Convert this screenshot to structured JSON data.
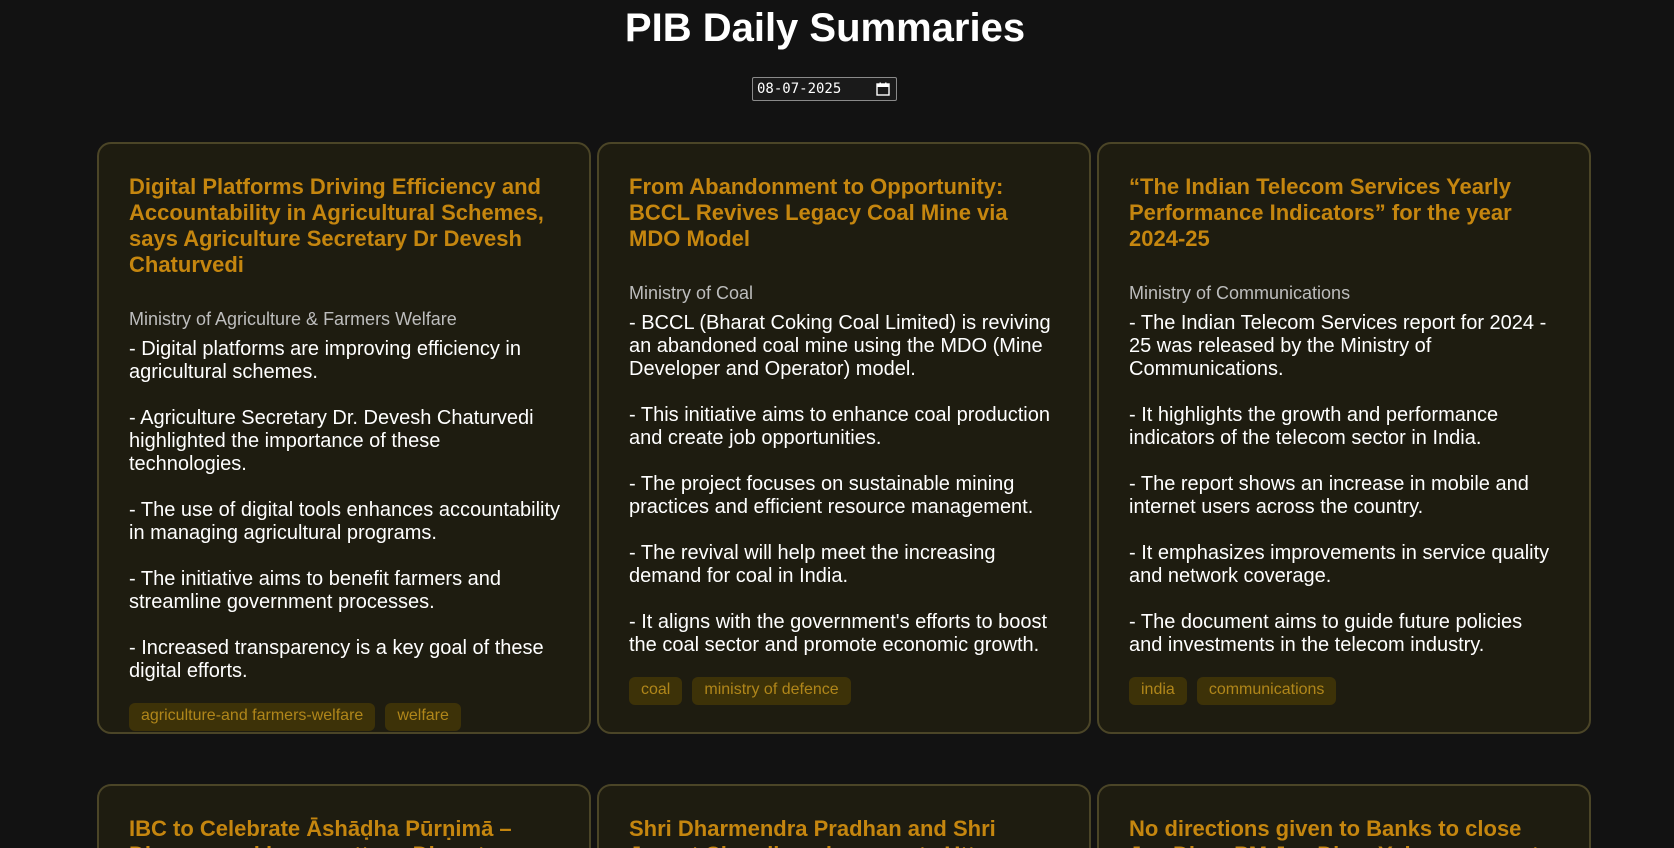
{
  "page": {
    "title": "PIB Daily Summaries"
  },
  "date_picker": {
    "value": "08-07-2025"
  },
  "cards": [
    {
      "title": "Digital Platforms Driving Efficiency and Accountability in Agricultural Schemes, says Agriculture Secretary Dr Devesh Chaturvedi",
      "ministry": "Ministry of Agriculture & Farmers Welfare",
      "points": [
        "- Digital platforms are improving efficiency in agricultural schemes.",
        "- Agriculture Secretary Dr. Devesh Chaturvedi highlighted the importance of these technologies.",
        "- The use of digital tools enhances accountability in managing agricultural programs.",
        "- The initiative aims to benefit farmers and streamline government processes.",
        "- Increased transparency is a key goal of these digital efforts."
      ],
      "tags": [
        "agriculture-and farmers-welfare",
        "welfare"
      ]
    },
    {
      "title": "From Abandonment to Opportunity: BCCL Revives Legacy Coal Mine via MDO Model",
      "ministry": "Ministry of Coal",
      "points": [
        "- BCCL (Bharat Coking Coal Limited) is reviving an abandoned coal mine using the MDO (Mine Developer and Operator) model.",
        "- This initiative aims to enhance coal production and create job opportunities.",
        "- The project focuses on sustainable mining practices and efficient resource management.",
        "- The revival will help meet the increasing demand for coal in India.",
        "- It aligns with the government's efforts to boost the coal sector and promote economic growth."
      ],
      "tags": [
        "coal",
        "ministry of defence"
      ]
    },
    {
      "title": "“The Indian Telecom Services Yearly Performance Indicators” for the year 2024-25",
      "ministry": "Ministry of Communications",
      "points": [
        "- The Indian Telecom Services report for 2024 - 25 was released by the Ministry of Communications.",
        "- It highlights the growth and performance indicators of the telecom sector in India.",
        "- The report shows an increase in mobile and internet users across the country.",
        "- It emphasizes improvements in service quality and network coverage.",
        "- The document aims to guide future policies and investments in the telecom industry."
      ],
      "tags": [
        "india",
        "communications"
      ]
    },
    {
      "title": "IBC to Celebrate Āshāḍha Pūrṇimā – Dhamma-cakkappavattana Divas to..."
    },
    {
      "title": "Shri Dharmendra Pradhan and Shri Jayant Chaudhary inaugurate Uttar..."
    },
    {
      "title": "No directions given to Banks to close Jan Dhan PM Jan Dhan Yojana accounts"
    }
  ]
}
